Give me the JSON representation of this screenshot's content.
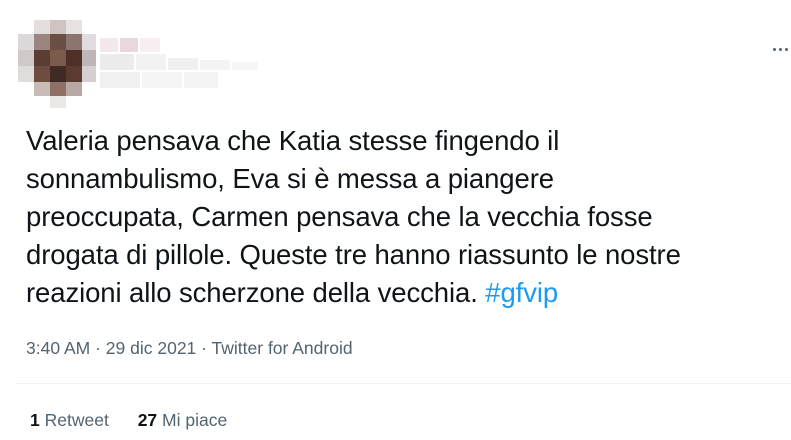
{
  "tweet": {
    "text_lines": [
      "Valeria pensava che Katia stesse fingendo il",
      "sonnambulismo, Eva si è messa a piangere",
      "preoccupata, Carmen pensava che la vecchia fosse",
      "drogata di pillole. Queste tre hanno riassunto le nostre"
    ],
    "text_last": "reazioni allo scherzone della vecchia. ",
    "hashtag": "#gfvip",
    "time": "3:40 AM",
    "date": "29 dic 2021",
    "source": "Twitter for Android",
    "separator": "·",
    "retweets": {
      "count": "1",
      "label": "Retweet"
    },
    "likes": {
      "count": "27",
      "label": "Mi piace"
    }
  },
  "colors": {
    "text": "#0f1419",
    "secondary": "#536471",
    "hashtag": "#1d9bf0",
    "divider": "#eff3f4"
  },
  "icons": [
    "more-icon"
  ]
}
